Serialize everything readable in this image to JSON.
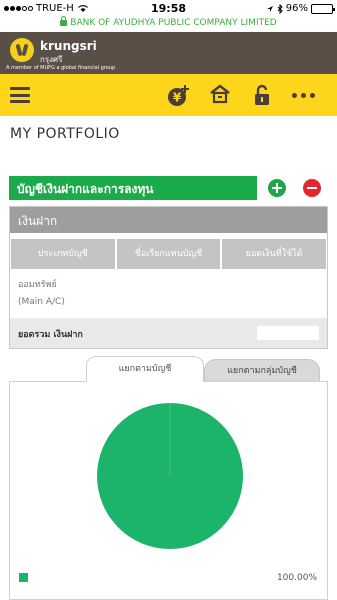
{
  "status_bar": {
    "carrier": "TRUE-H",
    "time": "19:58",
    "battery": "96%",
    "battery_level": 0.96
  },
  "secure_url": "BANK OF AYUDHYA PUBLIC COMPANY LIMITED",
  "brand": {
    "name": "krungsri",
    "name_thai": "กรุงศรี",
    "tagline": "A member of MUFG a global financial group"
  },
  "toolbar": {
    "icons": [
      "menu-icon",
      "wealth-icon",
      "home-icon",
      "unlock-icon",
      "more-icon"
    ]
  },
  "page_title": "MY PORTFOLIO",
  "section": {
    "title": "บัญชีเงินฝากและการลงทุน"
  },
  "deposit": {
    "title": "เงินฝาก",
    "columns": [
      "ประเภทบัญชี",
      "ชื่อเรียกแทนบัญชี",
      "ยอดเงินที่ใช้ได้"
    ],
    "rows": [
      {
        "type": "ออมทรัพย์",
        "name": "(Main A/C)",
        "balance": ""
      }
    ],
    "total_label": "ยอดรวม เงินฝาก",
    "total_value": ""
  },
  "tabs": [
    {
      "label": "แยกตามบัญชี",
      "active": true
    },
    {
      "label": "แยกตามกลุ่มบัญชี",
      "active": false
    }
  ],
  "colors": {
    "brand_header": "#5a4f47",
    "toolbar": "#fdd61b",
    "accent_green": "#1cab4b",
    "remove_red": "#e0282e",
    "chart_green": "#1cb36b"
  },
  "chart_data": {
    "type": "pie",
    "title": "",
    "slices": [
      {
        "label": "",
        "value": 100.0,
        "color": "#1cb36b"
      }
    ],
    "legend": [
      "100.00%"
    ]
  }
}
